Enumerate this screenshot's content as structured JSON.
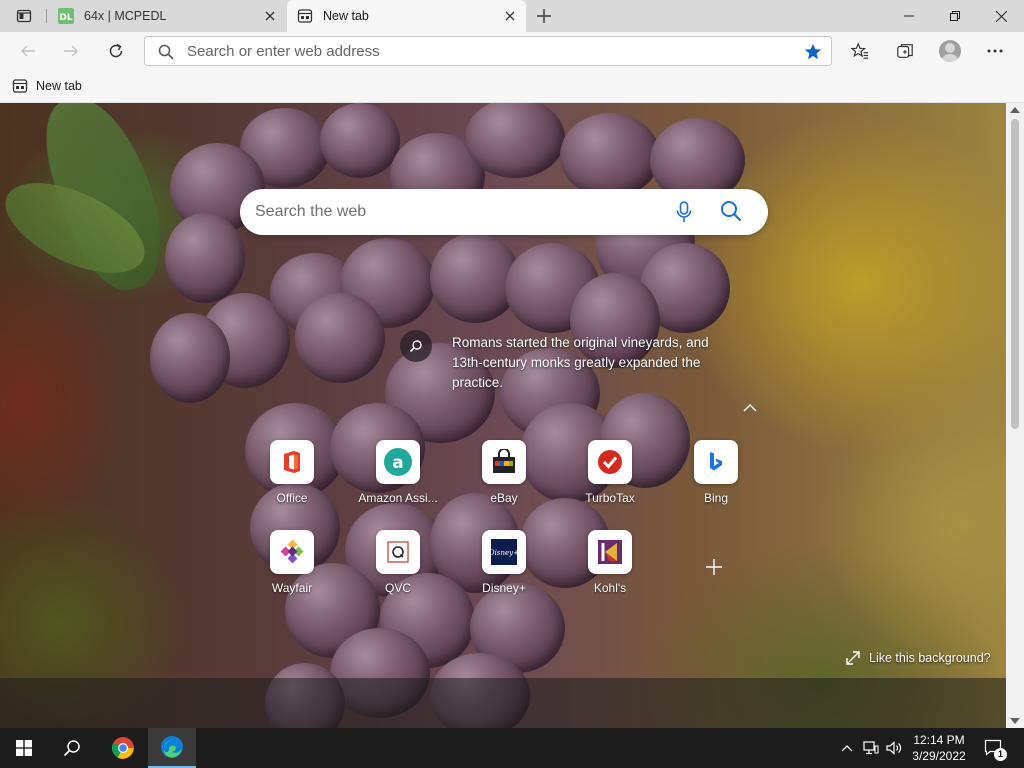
{
  "browser": {
    "tabs": [
      {
        "title": "64x | MCPEDL",
        "active": false
      },
      {
        "title": "New tab",
        "active": true
      }
    ],
    "address_bar": {
      "placeholder": "Search or enter web address",
      "value": ""
    },
    "favorites_bar": [
      {
        "label": "New tab"
      }
    ]
  },
  "new_tab_page": {
    "search_placeholder": "Search the web",
    "fact": "Romans started the original vineyards, and 13th-century monks greatly expanded the practice.",
    "tiles": [
      {
        "label": "Office",
        "icon": "office-icon"
      },
      {
        "label": "Amazon Assi...",
        "icon": "amazon-icon"
      },
      {
        "label": "eBay",
        "icon": "ebay-icon"
      },
      {
        "label": "TurboTax",
        "icon": "turbotax-icon"
      },
      {
        "label": "Bing",
        "icon": "bing-icon"
      },
      {
        "label": "Wayfair",
        "icon": "wayfair-icon"
      },
      {
        "label": "QVC",
        "icon": "qvc-icon"
      },
      {
        "label": "Disney+",
        "icon": "disney-plus-icon"
      },
      {
        "label": "Kohl's",
        "icon": "kohls-icon"
      }
    ],
    "like_background": "Like this background?"
  },
  "taskbar": {
    "time": "12:14 PM",
    "date": "3/29/2022",
    "notification_count": "1"
  },
  "colors": {
    "accent": "#0078d4",
    "tabstrip": "#d9d9d9",
    "toolbar": "#f7f7f7",
    "taskbar": "#1c1c1c"
  }
}
